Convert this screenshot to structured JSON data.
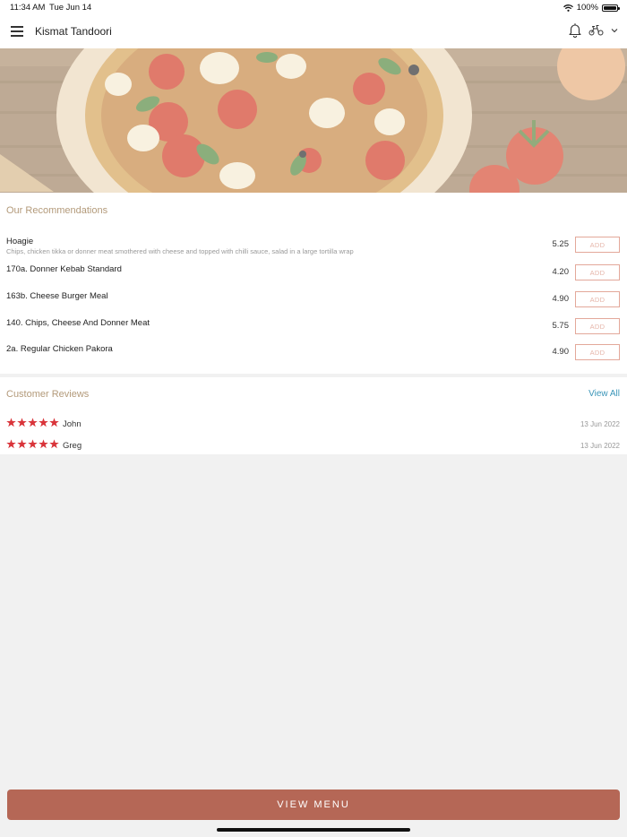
{
  "status_bar": {
    "time": "11:34 AM",
    "date": "Tue Jun 14",
    "battery": "100%"
  },
  "header": {
    "title": "Kismat Tandoori",
    "icons": [
      "menu-icon",
      "bell-icon",
      "delivery-scooter-icon",
      "chevron-down-icon"
    ]
  },
  "recommendations": {
    "title": "Our Recommendations",
    "add_label": "ADD",
    "items": [
      {
        "name": "Hoagie",
        "description": "Chips, chicken tikka or donner meat smothered with cheese and topped with chilli sauce, salad in a large tortilla wrap",
        "price": "5.25"
      },
      {
        "name": "170a. Donner Kebab Standard",
        "description": "",
        "price": "4.20"
      },
      {
        "name": "163b. Cheese Burger Meal",
        "description": "",
        "price": "4.90"
      },
      {
        "name": "140. Chips, Cheese And Donner Meat",
        "description": "",
        "price": "5.75"
      },
      {
        "name": "2a. Regular Chicken Pakora",
        "description": "",
        "price": "4.90"
      }
    ]
  },
  "reviews": {
    "title": "Customer Reviews",
    "view_all": "View All",
    "items": [
      {
        "name": "John",
        "date": "13 Jun 2022",
        "rating": 5
      },
      {
        "name": "Greg",
        "date": "13 Jun 2022",
        "rating": 5
      }
    ]
  },
  "footer": {
    "view_menu": "VIEW MENU"
  },
  "colors": {
    "accent": "#b56756",
    "section_title": "#b39a7a",
    "link": "#3a95b8",
    "star": "#d9343a"
  }
}
